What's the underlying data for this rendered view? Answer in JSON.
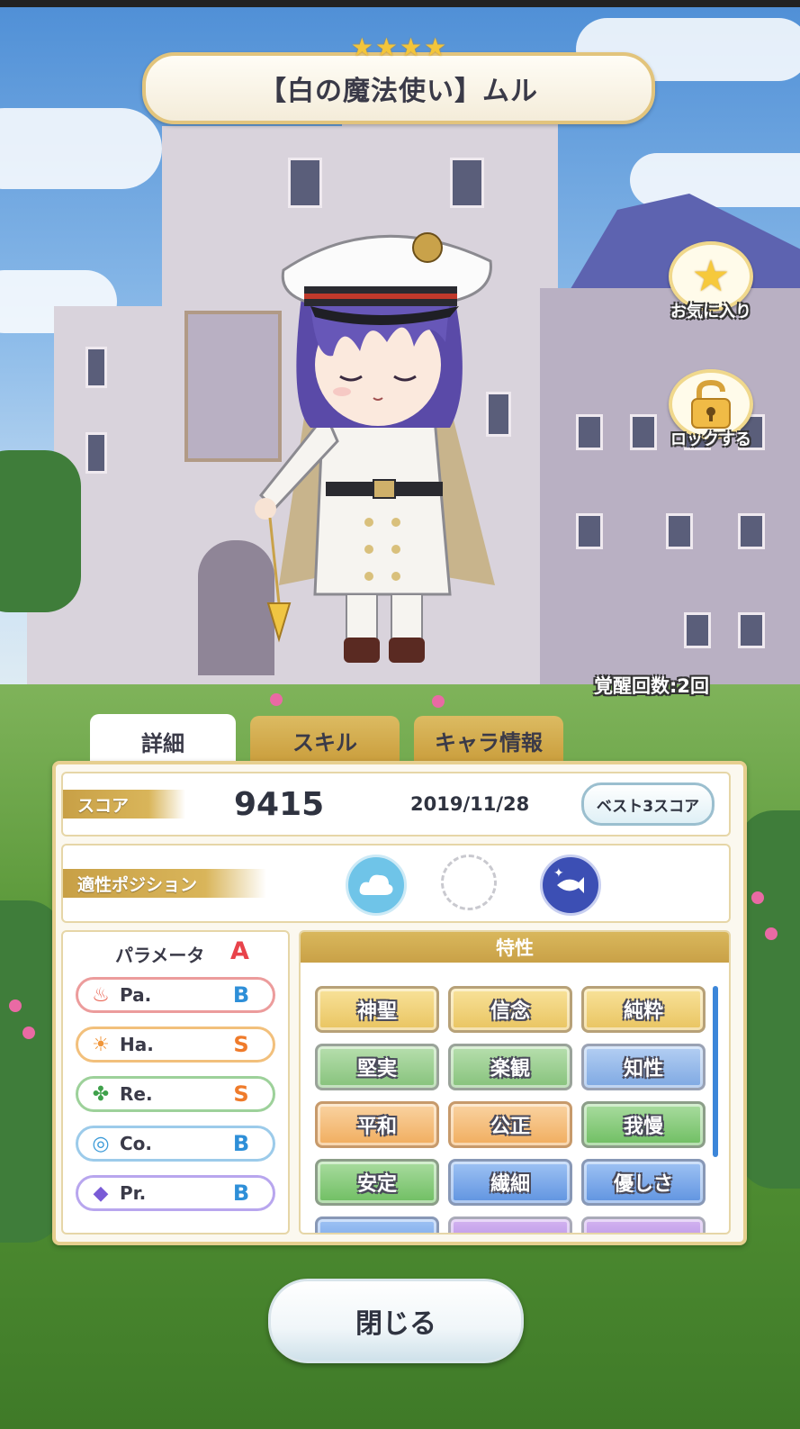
{
  "card": {
    "rarity_stars": 4,
    "title": "【白の魔法使い】ムル",
    "awakening": "覚醒回数:2回"
  },
  "side_buttons": {
    "favorite_label": "お気に入り",
    "lock_label": "ロックする"
  },
  "tabs": [
    {
      "label": "詳細",
      "active": true
    },
    {
      "label": "スキル",
      "active": false
    },
    {
      "label": "キャラ情報",
      "active": false
    }
  ],
  "score": {
    "label": "スコア",
    "value": "9415",
    "date": "2019/11/28",
    "best_button": "ベスト3スコア"
  },
  "position": {
    "label": "適性ポジション",
    "icons": [
      "cloud-icon",
      "empty-slot",
      "fish-moon-icon"
    ]
  },
  "parameters": {
    "label": "パラメータ",
    "overall_grade": "A",
    "rows": [
      {
        "name": "Pa.",
        "grade": "B",
        "icon": "fire-icon",
        "color": "#e85b4a",
        "border": "#ec9c9c"
      },
      {
        "name": "Ha.",
        "grade": "S",
        "icon": "sun-icon",
        "color": "#f0963a",
        "border": "#f2c07c"
      },
      {
        "name": "Re.",
        "grade": "S",
        "icon": "clover-icon",
        "color": "#3fa14b",
        "border": "#9dd19a"
      },
      {
        "name": "Co.",
        "grade": "B",
        "icon": "swirl-icon",
        "color": "#3b9ad8",
        "border": "#9ccbea"
      },
      {
        "name": "Pr.",
        "grade": "B",
        "icon": "diamond-icon",
        "color": "#7a5bd6",
        "border": "#b8a6ee"
      }
    ],
    "grade_colors": {
      "A": "#e8434b",
      "S": "#ef7b2b",
      "B": "#2e8fd8"
    }
  },
  "traits": {
    "label": "特性",
    "items": [
      {
        "label": "神聖",
        "style": "t-gold"
      },
      {
        "label": "信念",
        "style": "t-gold"
      },
      {
        "label": "純粋",
        "style": "t-gold"
      },
      {
        "label": "堅実",
        "style": "t-green"
      },
      {
        "label": "楽観",
        "style": "t-green"
      },
      {
        "label": "知性",
        "style": "t-blue"
      },
      {
        "label": "平和",
        "style": "t-orange"
      },
      {
        "label": "公正",
        "style": "t-orange"
      },
      {
        "label": "我慢",
        "style": "t-green2"
      },
      {
        "label": "安定",
        "style": "t-green2"
      },
      {
        "label": "繊細",
        "style": "t-blue2"
      },
      {
        "label": "優しさ",
        "style": "t-blue2"
      }
    ]
  },
  "close_button": "閉じる"
}
